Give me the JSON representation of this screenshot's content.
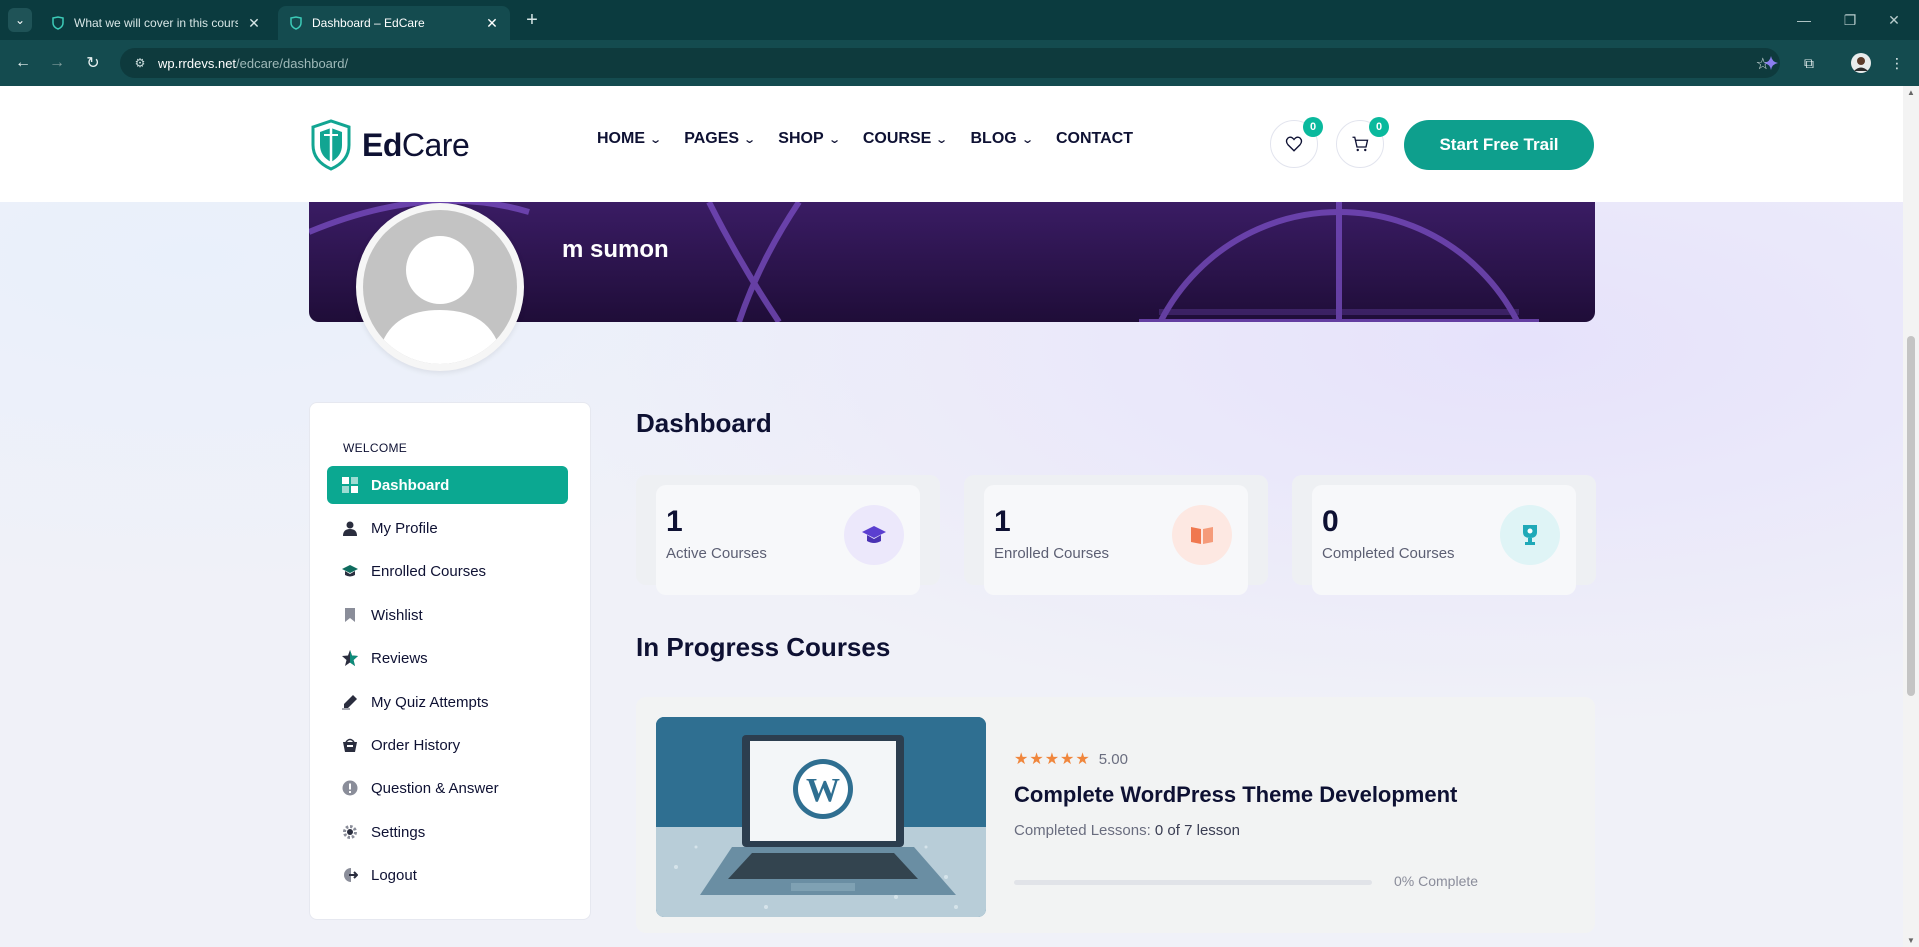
{
  "browser": {
    "tabs": [
      {
        "title": "What we will cover in this cours",
        "active": false
      },
      {
        "title": "Dashboard – EdCare",
        "active": true
      }
    ],
    "url_host": "wp.rrdevs.net",
    "url_path": "/edcare/dashboard/"
  },
  "header": {
    "logo_bold": "Ed",
    "logo_regular": "Care",
    "nav": [
      {
        "label": "HOME",
        "dropdown": true
      },
      {
        "label": "PAGES",
        "dropdown": true
      },
      {
        "label": "SHOP",
        "dropdown": true
      },
      {
        "label": "COURSE",
        "dropdown": true
      },
      {
        "label": "BLOG",
        "dropdown": true
      },
      {
        "label": "CONTACT",
        "dropdown": false
      }
    ],
    "wishlist_count": "0",
    "cart_count": "0",
    "cta_label": "Start Free Trail"
  },
  "profile": {
    "name": "m sumon"
  },
  "sidebar": {
    "section_label": "WELCOME",
    "items": [
      {
        "label": "Dashboard",
        "icon": "dashboard-icon",
        "active": true
      },
      {
        "label": "My Profile",
        "icon": "user-icon",
        "active": false
      },
      {
        "label": "Enrolled Courses",
        "icon": "graduation-cap-icon",
        "active": false
      },
      {
        "label": "Wishlist",
        "icon": "bookmark-icon",
        "active": false
      },
      {
        "label": "Reviews",
        "icon": "star-icon",
        "active": false
      },
      {
        "label": "My Quiz Attempts",
        "icon": "quiz-pen-icon",
        "active": false
      },
      {
        "label": "Order History",
        "icon": "basket-icon",
        "active": false
      },
      {
        "label": "Question & Answer",
        "icon": "question-icon",
        "active": false
      },
      {
        "label": "Settings",
        "icon": "gear-icon",
        "active": false
      },
      {
        "label": "Logout",
        "icon": "logout-icon",
        "active": false
      }
    ]
  },
  "main": {
    "dashboard_title": "Dashboard",
    "stats": [
      {
        "value": "1",
        "label": "Active Courses",
        "icon": "graduation-cap-icon",
        "bg": "#ece8fb",
        "fg": "#5b3fd0"
      },
      {
        "value": "1",
        "label": "Enrolled Courses",
        "icon": "open-book-icon",
        "bg": "#fde8e2",
        "fg": "#f0784f"
      },
      {
        "value": "0",
        "label": "Completed Courses",
        "icon": "trophy-icon",
        "bg": "#dff4f6",
        "fg": "#1fa9b8"
      }
    ],
    "in_progress_title": "In Progress Courses",
    "course": {
      "stars": "★★★★★",
      "rating": "5.00",
      "title": "Complete WordPress Theme Development",
      "lessons_label": "Completed Lessons:",
      "lessons_value": "0 of 7 lesson",
      "progress_percent": 0,
      "progress_label": "0% Complete"
    }
  },
  "colors": {
    "accent": "#0ba891",
    "banner": "#2a1450",
    "heading": "#0e1133"
  }
}
